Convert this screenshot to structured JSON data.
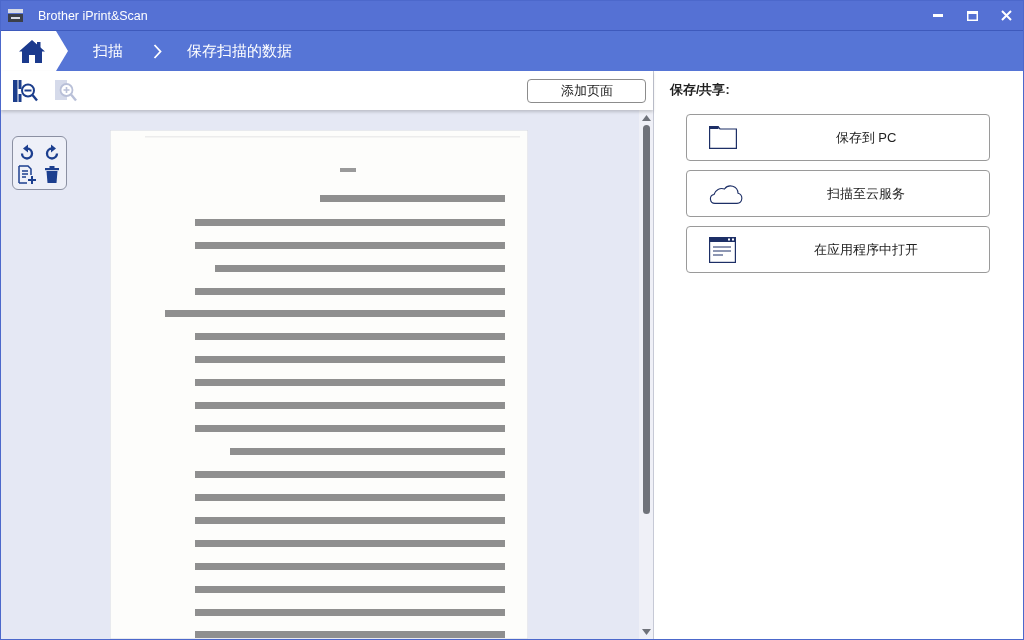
{
  "window": {
    "title": "Brother iPrint&Scan"
  },
  "breadcrumb": {
    "items": [
      "扫描",
      "保存扫描的数据"
    ]
  },
  "toolbar": {
    "zoom_tools": [
      {
        "kind": "zoom-out",
        "disabled": false
      },
      {
        "kind": "zoom-in",
        "disabled": true
      }
    ],
    "add_page_button": "添加页面"
  },
  "share": {
    "heading": "保存/共享:",
    "actions": [
      {
        "kind": "folder",
        "label": "保存到 PC"
      },
      {
        "kind": "cloud",
        "label": "扫描至云服务"
      },
      {
        "kind": "app",
        "label": "在应用程序中打开"
      }
    ]
  }
}
